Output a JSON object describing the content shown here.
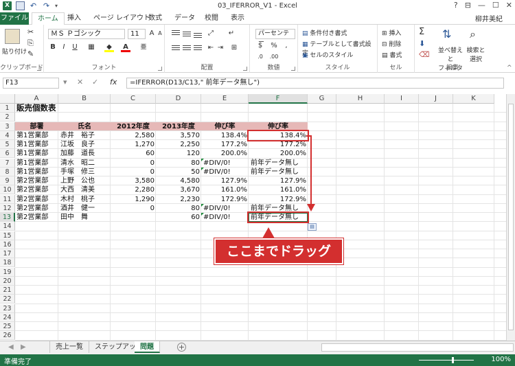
{
  "window": {
    "title": "03_IFERROR_V1 - Excel",
    "user": "柳井美紀",
    "controls": [
      "?",
      "⊟",
      "—",
      "☐",
      "✕"
    ]
  },
  "ribbon_tabs": [
    "ファイル",
    "ホーム",
    "挿入",
    "ページ レイアウト",
    "数式",
    "データ",
    "校閲",
    "表示"
  ],
  "ribbon": {
    "clipboard": {
      "paste": "貼り付け",
      "label": "クリップボード"
    },
    "font": {
      "name": "ＭＳ Ｐゴシック",
      "size": "11",
      "label": "フォント"
    },
    "alignment": {
      "label": "配置"
    },
    "number": {
      "format": "パーセンテー",
      "label": "数値"
    },
    "styles": {
      "cond": "条件付き書式",
      "table": "テーブルとして書式設定",
      "cell": "セルのスタイル",
      "label": "スタイル"
    },
    "cells": {
      "insert": "挿入",
      "delete": "削除",
      "format": "書式",
      "label": "セル"
    },
    "editing": {
      "sort": "並べ替えと\nフィルター",
      "find": "検索と\n選択",
      "label": "編集"
    }
  },
  "formula_bar": {
    "name_box": "F13",
    "formula": "=IFERROR(D13/C13,\" 前年データ無し\")"
  },
  "columns": [
    "A",
    "B",
    "C",
    "D",
    "E",
    "F",
    "G",
    "H",
    "I",
    "J",
    "K"
  ],
  "rows": [
    "1",
    "2",
    "3",
    "4",
    "5",
    "6",
    "7",
    "8",
    "9",
    "10",
    "11",
    "12",
    "13",
    "14",
    "15",
    "16",
    "17",
    "18",
    "19",
    "20",
    "21",
    "22",
    "23",
    "24",
    "25",
    "26"
  ],
  "sheet": {
    "title": "販売個数表",
    "headers": [
      "部署",
      "氏名",
      "2012年度",
      "2013年度",
      "伸び率",
      "伸び率"
    ],
    "data": [
      [
        "第1営業部",
        "赤井　裕子",
        "2,580",
        "3,570",
        "138.4%",
        "138.4%"
      ],
      [
        "第1営業部",
        "江坂　良子",
        "1,270",
        "2,250",
        "177.2%",
        "177.2%"
      ],
      [
        "第1営業部",
        "加藤　道長",
        "60",
        "120",
        "200.0%",
        "200.0%"
      ],
      [
        "第1営業部",
        "清水　昭二",
        "0",
        "80",
        "#DIV/0!",
        "前年データ無し"
      ],
      [
        "第1営業部",
        "手塚　修三",
        "0",
        "50",
        "#DIV/0!",
        "前年データ無し"
      ],
      [
        "第2営業部",
        "上野　公也",
        "3,580",
        "4,580",
        "127.9%",
        "127.9%"
      ],
      [
        "第2営業部",
        "大西　清美",
        "2,280",
        "3,670",
        "161.0%",
        "161.0%"
      ],
      [
        "第2営業部",
        "木村　桃子",
        "1,290",
        "2,230",
        "172.9%",
        "172.9%"
      ],
      [
        "第2営業部",
        "酒井　健一",
        "0",
        "80",
        "#DIV/0!",
        "前年データ無し"
      ],
      [
        "第2営業部",
        "田中　舞",
        "",
        "60",
        "#DIV/0!",
        "前年データ無し"
      ]
    ]
  },
  "callout": "ここまでドラッグ",
  "sheet_tabs": [
    "売上一覧",
    "ステップアップ",
    "問題"
  ],
  "status": {
    "ready": "準備完了",
    "zoom": "100%"
  }
}
